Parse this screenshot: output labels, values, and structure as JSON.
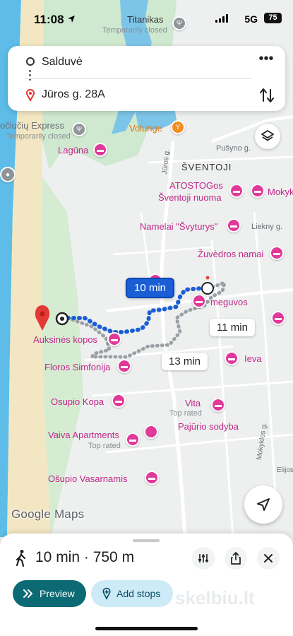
{
  "status_bar": {
    "time": "11:08",
    "network": "5G",
    "battery": "75"
  },
  "route": {
    "origin": "Salduvė",
    "destination": "Jūros g. 28A",
    "more_label": "•••"
  },
  "map": {
    "places": [
      {
        "name": "Titanikas",
        "style": "dark"
      },
      {
        "name": "Temporarily closed",
        "style": "gray"
      },
      {
        "name": "očiučių Express",
        "style": "gray-dark"
      },
      {
        "name": "Temporarily closed",
        "style": "gray"
      },
      {
        "name": "Lagūna",
        "style": "pink"
      },
      {
        "name": "Volunge",
        "style": "orange"
      },
      {
        "name": "ŠVENTOJI",
        "style": "area"
      },
      {
        "name": "ATOSTOGos",
        "style": "pink"
      },
      {
        "name": "Šventoji nuoma",
        "style": "pink"
      },
      {
        "name": "Mokyk",
        "style": "pink"
      },
      {
        "name": "Namelai \"Švyturys\"",
        "style": "pink"
      },
      {
        "name": "Liekny g.",
        "style": "street"
      },
      {
        "name": "Žuvėdros namai",
        "style": "pink"
      },
      {
        "name": "meguvos",
        "style": "pink"
      },
      {
        "name": "Auksinės kopos",
        "style": "pink"
      },
      {
        "name": "Floros Simfonija",
        "style": "pink"
      },
      {
        "name": "Ieva",
        "style": "pink"
      },
      {
        "name": "Osupio Kopa",
        "style": "pink"
      },
      {
        "name": "Vita",
        "style": "pink"
      },
      {
        "name": "Top rated",
        "style": "gray"
      },
      {
        "name": "Pajūrio sodyba",
        "style": "pink"
      },
      {
        "name": "Vaiva Apartments",
        "style": "pink"
      },
      {
        "name": "Top rated",
        "style": "gray"
      },
      {
        "name": "Ošupio Vasarnamis",
        "style": "pink"
      },
      {
        "name": "Mokyklos g.",
        "style": "street"
      },
      {
        "name": "Pušyno g.",
        "style": "street"
      },
      {
        "name": "Jūros g.",
        "style": "street"
      },
      {
        "name": "Elijos",
        "style": "street"
      }
    ],
    "eta_selected": "10 min",
    "eta_alt1": "11 min",
    "eta_alt2": "13 min",
    "logo": "Google Maps"
  },
  "sheet": {
    "summary": "10 min · 750 m",
    "preview_label": "Preview",
    "add_stops_label": "Add stops",
    "watermark": "skelbiu.lt"
  },
  "colors": {
    "route_blue": "#1a5ed6",
    "accent_teal": "#0b6a73",
    "poi_pink": "#e0399a",
    "sea": "#5dbde8",
    "beach": "#f3e6c4"
  }
}
